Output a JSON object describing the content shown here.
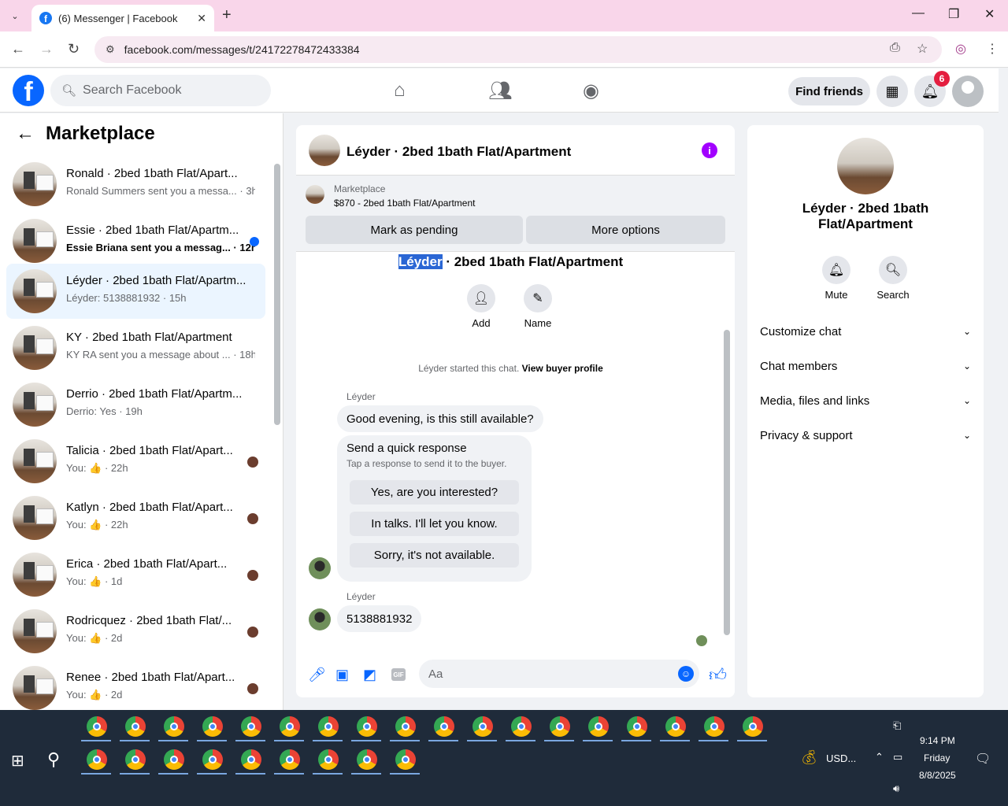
{
  "browser": {
    "tab_title": "(6) Messenger | Facebook",
    "url": "facebook.com/messages/t/24172278472433384"
  },
  "topbar": {
    "search_placeholder": "Search Facebook",
    "find_friends": "Find friends",
    "notif_count": "6"
  },
  "left": {
    "title": "Marketplace",
    "conversations": [
      {
        "name": "Ronald · 2bed 1bath Flat/Apart...",
        "sub": "Ronald Summers sent you a messa... · 3h"
      },
      {
        "name": "Essie · 2bed 1bath Flat/Apartm...",
        "sub": "Essie Briana sent you a messag... · 12h",
        "unread": true
      },
      {
        "name": "Léyder · 2bed 1bath Flat/Apartm...",
        "sub": "Léyder: 5138881932 · 15h",
        "selected": true
      },
      {
        "name": "KY · 2bed 1bath Flat/Apartment",
        "sub": "KY RA sent you a message about ... · 18h"
      },
      {
        "name": "Derrio · 2bed 1bath Flat/Apartm...",
        "sub": "Derrio: Yes · 19h"
      },
      {
        "name": "Talicia · 2bed 1bath Flat/Apart...",
        "sub": "You: 👍 · 22h"
      },
      {
        "name": "Katlyn · 2bed 1bath Flat/Apart...",
        "sub": "You: 👍 · 22h"
      },
      {
        "name": "Erica · 2bed 1bath Flat/Apart...",
        "sub": "You: 👍 · 1d"
      },
      {
        "name": "Rodricquez · 2bed 1bath Flat/...",
        "sub": "You: 👍 · 2d"
      },
      {
        "name": "Renee · 2bed 1bath Flat/Apart...",
        "sub": "You: 👍 · 2d"
      }
    ]
  },
  "chat": {
    "title": "Léyder · 2bed 1bath Flat/Apartment",
    "marketplace_label": "Marketplace",
    "listing": "$870 - 2bed 1bath Flat/Apartment",
    "mark_pending": "Mark as pending",
    "more_options": "More options",
    "thread_title_hl": "Léyder",
    "thread_title_rest": " · 2bed 1bath Flat/Apartment",
    "add_label": "Add",
    "name_label": "Name",
    "started_text": "Léyder started this chat.",
    "view_buyer": "View buyer profile",
    "sender": "Léyder",
    "msg1": "Good evening, is this still available?",
    "quick_title": "Send a quick response",
    "quick_sub": "Tap a response to send it to the buyer.",
    "quick_opts": [
      "Yes, are you interested?",
      "In talks. I'll let you know.",
      "Sorry, it's not available."
    ],
    "msg2": "5138881932",
    "composer_placeholder": "Aa",
    "gif": "GIF"
  },
  "right": {
    "name": "Léyder · 2bed 1bath Flat/Apartment",
    "mute": "Mute",
    "search": "Search",
    "sections": [
      "Customize chat",
      "Chat members",
      "Media, files and links",
      "Privacy & support"
    ]
  },
  "taskbar": {
    "currency": "USD...",
    "time": "9:14 PM",
    "day": "Friday",
    "date": "8/8/2025"
  }
}
